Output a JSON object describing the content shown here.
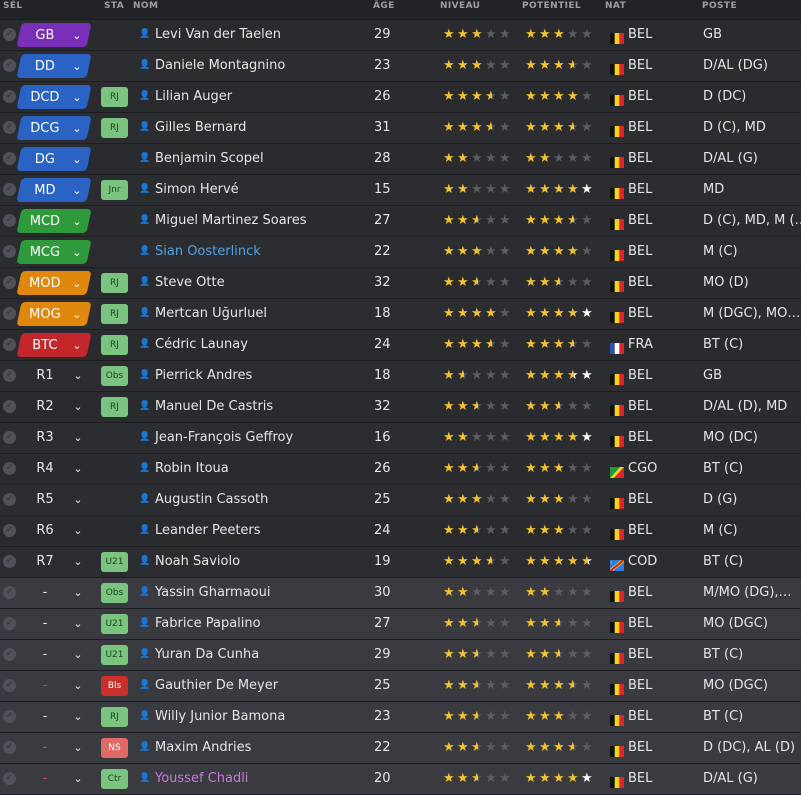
{
  "headers": {
    "sel": "SÉL",
    "sta": "STA",
    "nom": "NOM",
    "age": "ÂGE",
    "niveau": "NIVEAU",
    "potentiel": "POTENTIEL",
    "nat": "NAT",
    "poste": "POSTE"
  },
  "colors": {
    "gold": "#f2c230",
    "empty": "#5b5d63",
    "white": "#ffffff",
    "name_blue": "#4fa3e0",
    "name_pink": "#c77ad9"
  },
  "icons": {
    "checkbox": "check-icon",
    "person": "person-icon",
    "chevron": "chevron-down-icon"
  },
  "players": [
    {
      "pos": "GB",
      "pos_color": "#7a2fb8",
      "status": "",
      "name": "Levi Van der Taelen",
      "age": "29",
      "level": 3,
      "potential": 3,
      "nat": "BEL",
      "flag": "bel",
      "poste": "GB"
    },
    {
      "pos": "DD",
      "pos_color": "#2a63c4",
      "status": "",
      "name": "Daniele Montagnino",
      "age": "23",
      "level": 3,
      "potential": 3.5,
      "nat": "BEL",
      "flag": "bel",
      "poste": "D/AL (DG)"
    },
    {
      "pos": "DCD",
      "pos_color": "#2a63c4",
      "status": "RJ",
      "status_style": "green",
      "name": "Lilian Auger",
      "age": "26",
      "level": 3.5,
      "potential": 4,
      "nat": "BEL",
      "flag": "bel",
      "poste": "D (DC)"
    },
    {
      "pos": "DCG",
      "pos_color": "#2a63c4",
      "status": "RJ",
      "status_style": "green",
      "name": "Gilles Bernard",
      "age": "31",
      "level": 3.5,
      "potential": 3.5,
      "nat": "BEL",
      "flag": "bel",
      "poste": "D (C), MD"
    },
    {
      "pos": "DG",
      "pos_color": "#2a63c4",
      "status": "",
      "name": "Benjamin Scopel",
      "age": "28",
      "level": 2,
      "potential": 2,
      "nat": "BEL",
      "flag": "bel",
      "poste": "D/AL (G)"
    },
    {
      "pos": "MD",
      "pos_color": "#2a63c4",
      "status": "Jnr",
      "status_style": "green",
      "name": "Simon Hervé",
      "age": "15",
      "level": 2,
      "potential": 4,
      "potential_white": true,
      "nat": "BEL",
      "flag": "bel",
      "poste": "MD"
    },
    {
      "pos": "MCD",
      "pos_color": "#2f9a3c",
      "status": "",
      "name": "Miguel Martinez Soares",
      "age": "27",
      "level": 2.5,
      "potential": 3.5,
      "nat": "BEL",
      "flag": "bel",
      "poste": "D (C), MD, M (…"
    },
    {
      "pos": "MCG",
      "pos_color": "#2f9a3c",
      "status": "",
      "name": "Sian Oosterlinck",
      "name_color": "#4fa3e0",
      "age": "22",
      "level": 3,
      "potential": 4,
      "nat": "BEL",
      "flag": "bel",
      "poste": "M (C)"
    },
    {
      "pos": "MOD",
      "pos_color": "#e0870e",
      "status": "RJ",
      "status_style": "green",
      "name": "Steve Otte",
      "age": "32",
      "level": 2.5,
      "potential": 2.5,
      "nat": "BEL",
      "flag": "bel",
      "poste": "MO (D)"
    },
    {
      "pos": "MOG",
      "pos_color": "#e0870e",
      "status": "RJ",
      "status_style": "green",
      "name": "Mertcan Uğurluel",
      "age": "18",
      "level": 4,
      "potential": 4,
      "potential_white": true,
      "nat": "BEL",
      "flag": "bel",
      "poste": "M (DGC), MO…"
    },
    {
      "pos": "BTC",
      "pos_color": "#c3272b",
      "status": "RJ",
      "status_style": "green",
      "name": "Cédric Launay",
      "age": "24",
      "level": 3.5,
      "potential": 3.5,
      "nat": "FRA",
      "flag": "fra",
      "poste": "BT (C)"
    },
    {
      "pos": "R1",
      "pos_color": "",
      "status": "Obs",
      "status_style": "green",
      "name": "Pierrick Andres",
      "age": "18",
      "level": 1.5,
      "potential": 3.5,
      "potential_white": true,
      "nat": "BEL",
      "flag": "bel",
      "poste": "GB"
    },
    {
      "pos": "R2",
      "pos_color": "",
      "status": "RJ",
      "status_style": "green",
      "name": "Manuel De Castris",
      "age": "32",
      "level": 2.5,
      "potential": 2.5,
      "nat": "BEL",
      "flag": "bel",
      "poste": "D/AL (D), MD"
    },
    {
      "pos": "R3",
      "pos_color": "",
      "status": "",
      "name": "Jean-François Geffroy",
      "age": "16",
      "level": 2,
      "potential": 4,
      "potential_white": true,
      "nat": "BEL",
      "flag": "bel",
      "poste": "MO (DC)"
    },
    {
      "pos": "R4",
      "pos_color": "",
      "status": "",
      "name": "Robin Itoua",
      "age": "26",
      "level": 2.5,
      "potential": 3,
      "nat": "CGO",
      "flag": "cgo",
      "poste": "BT (C)"
    },
    {
      "pos": "R5",
      "pos_color": "",
      "status": "",
      "name": "Augustin Cassoth",
      "age": "25",
      "level": 3,
      "potential": 3,
      "nat": "BEL",
      "flag": "bel",
      "poste": "D (G)"
    },
    {
      "pos": "R6",
      "pos_color": "",
      "status": "",
      "name": "Leander Peeters",
      "age": "24",
      "level": 2.5,
      "potential": 3,
      "nat": "BEL",
      "flag": "bel",
      "poste": "M (C)"
    },
    {
      "pos": "R7",
      "pos_color": "",
      "status": "U21",
      "status_style": "green",
      "name": "Noah Saviolo",
      "age": "19",
      "level": 3.5,
      "potential": 4.5,
      "potential_white": true,
      "nat": "COD",
      "flag": "cod",
      "poste": "BT (C)"
    },
    {
      "pos": "-",
      "pos_color": "",
      "status": "Obs",
      "status_style": "green",
      "reserve": true,
      "name": "Yassin Gharmaoui",
      "age": "30",
      "level": 2,
      "potential": 2,
      "nat": "BEL",
      "flag": "bel",
      "poste": "M/MO (DG),…"
    },
    {
      "pos": "-",
      "pos_color": "",
      "status": "U21",
      "status_style": "green",
      "reserve": true,
      "name": "Fabrice Papalino",
      "age": "27",
      "level": 2.5,
      "potential": 2.5,
      "nat": "BEL",
      "flag": "bel",
      "poste": "MO (DGC)"
    },
    {
      "pos": "-",
      "pos_color": "",
      "status": "U21",
      "status_style": "green",
      "reserve": true,
      "name": "Yuran Da Cunha",
      "age": "29",
      "level": 2.5,
      "potential": 2.5,
      "nat": "BEL",
      "flag": "bel",
      "poste": "BT (C)"
    },
    {
      "pos": "-",
      "pos_color": "",
      "status": "Bls",
      "status_style": "red",
      "reserve": true,
      "name": "Gauthier De Meyer",
      "age": "25",
      "level": 2.5,
      "potential": 3.5,
      "nat": "BEL",
      "flag": "bel",
      "poste": "MO (DGC)"
    },
    {
      "pos": "-",
      "pos_color": "",
      "status": "RJ",
      "status_style": "green",
      "reserve": true,
      "name": "Willy Junior Bamona",
      "age": "23",
      "level": 2.5,
      "potential": 3,
      "nat": "BEL",
      "flag": "bel",
      "poste": "BT (C)"
    },
    {
      "pos": "-",
      "pos_color": "",
      "status": "NS",
      "status_style": "salmon",
      "reserve": true,
      "name": "Maxim Andries",
      "age": "22",
      "level": 2.5,
      "potential": 3.5,
      "nat": "BEL",
      "flag": "bel",
      "poste": "D (DC), AL (D)"
    },
    {
      "pos": "-",
      "pos_color": "",
      "status": "Ctr",
      "status_style": "green",
      "reserve": true,
      "name": "Youssef Chadli",
      "name_color": "#c77ad9",
      "age": "20",
      "level": 2.5,
      "potential": 4,
      "potential_white": true,
      "nat": "BEL",
      "flag": "bel",
      "poste": "D/AL (G)"
    }
  ]
}
